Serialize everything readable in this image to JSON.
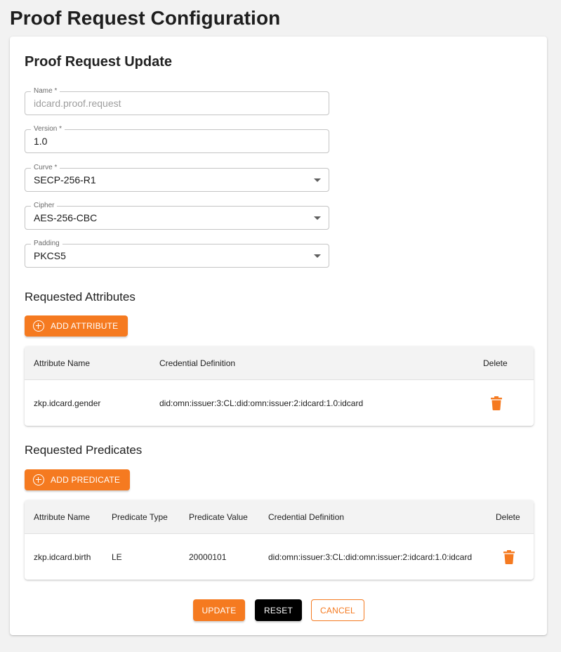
{
  "page": {
    "title": "Proof Request Configuration"
  },
  "form": {
    "title": "Proof Request Update",
    "name": {
      "label": "Name *",
      "value": "idcard.proof.request"
    },
    "version": {
      "label": "Version *",
      "value": "1.0"
    },
    "curve": {
      "label": "Curve *",
      "value": "SECP-256-R1"
    },
    "cipher": {
      "label": "Cipher",
      "value": "AES-256-CBC"
    },
    "padding": {
      "label": "Padding",
      "value": "PKCS5"
    }
  },
  "attributes": {
    "title": "Requested Attributes",
    "add_label": "ADD ATTRIBUTE",
    "columns": [
      "Attribute Name",
      "Credential Definition",
      "Delete"
    ],
    "rows": [
      {
        "name": "zkp.idcard.gender",
        "cred_def": "did:omn:issuer:3:CL:did:omn:issuer:2:idcard:1.0:idcard"
      }
    ]
  },
  "predicates": {
    "title": "Requested Predicates",
    "add_label": "ADD PREDICATE",
    "columns": [
      "Attribute Name",
      "Predicate Type",
      "Predicate Value",
      "Credential Definition",
      "Delete"
    ],
    "rows": [
      {
        "name": "zkp.idcard.birth",
        "type": "LE",
        "value": "20000101",
        "cred_def": "did:omn:issuer:3:CL:did:omn:issuer:2:idcard:1.0:idcard"
      }
    ]
  },
  "actions": {
    "update": "UPDATE",
    "reset": "RESET",
    "cancel": "CANCEL"
  },
  "colors": {
    "accent": "#f57a20",
    "reset": "#000000"
  },
  "icons": {
    "add": "plus-circle-icon",
    "delete": "trash-icon",
    "select": "caret-down-icon"
  }
}
